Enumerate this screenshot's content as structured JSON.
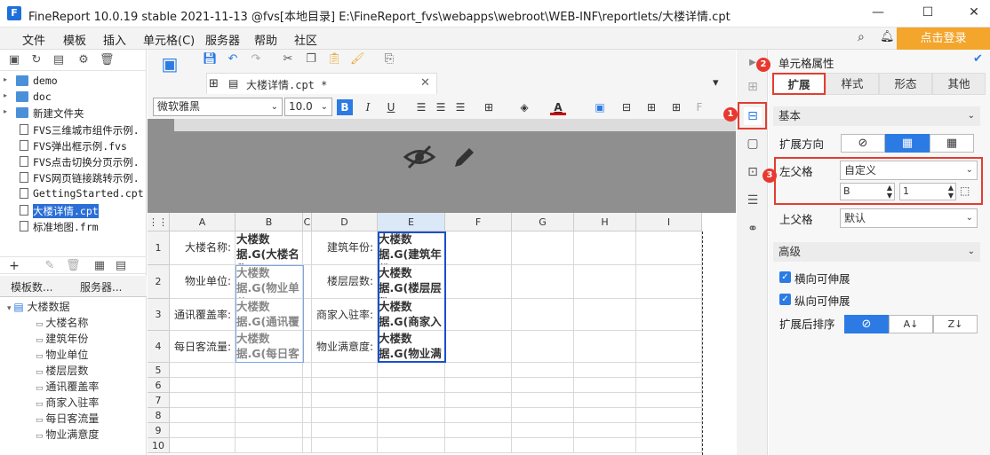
{
  "app": {
    "logo_letter": "F",
    "title": "FineReport 10.0.19 stable 2021-11-13 @fvs[本地目录]    E:\\FineReport_fvs\\webapps\\webroot\\WEB-INF\\reportlets/大楼详情.cpt",
    "login_label": "点击登录"
  },
  "menu": [
    "文件",
    "模板",
    "插入",
    "单元格(C)",
    "服务器",
    "帮助",
    "社区"
  ],
  "file_tree": [
    {
      "name": "demo",
      "type": "folder"
    },
    {
      "name": "doc",
      "type": "folder"
    },
    {
      "name": "新建文件夹",
      "type": "folder"
    },
    {
      "name": "FVS三维城市组件示例.",
      "type": "file"
    },
    {
      "name": "FVS弹出框示例.fvs",
      "type": "file"
    },
    {
      "name": "FVS点击切换分页示例.",
      "type": "file"
    },
    {
      "name": "FVS网页链接跳转示例.",
      "type": "file"
    },
    {
      "name": "GettingStarted.cpt",
      "type": "file"
    },
    {
      "name": "大楼详情.cpt",
      "type": "file",
      "selected": true
    },
    {
      "name": "标准地图.frm",
      "type": "file"
    }
  ],
  "left_tabs": [
    "模板数...",
    "服务器..."
  ],
  "dataset": {
    "name": "大楼数据",
    "fields": [
      "大楼名称",
      "建筑年份",
      "物业单位",
      "楼层层数",
      "通讯覆盖率",
      "商家入驻率",
      "每日客流量",
      "物业满意度"
    ]
  },
  "editor_tab": "大楼详情.cpt *",
  "format": {
    "font": "微软雅黑",
    "size": "10.0"
  },
  "sheet": {
    "columns": [
      "A",
      "B",
      "C",
      "D",
      "E",
      "F",
      "G",
      "H",
      "I"
    ],
    "rows": [
      "1",
      "2",
      "3",
      "4",
      "5",
      "6",
      "7",
      "8",
      "9",
      "10"
    ],
    "labels_a": [
      "大楼名称:",
      "物业单位:",
      "通讯覆盖率:",
      "每日客流量:"
    ],
    "fields_b": [
      "大楼数据.G(大楼名称)",
      "大楼数据.G(物业单位)",
      "大楼数据.G(通讯覆盖率)",
      "大楼数据.G(每日客流量)"
    ],
    "labels_d": [
      "建筑年份:",
      "楼层层数:",
      "商家入驻率:",
      "物业满意度:"
    ],
    "fields_e": [
      "大楼数据.G(建筑年份)",
      "大楼数据.G(楼层层数)",
      "大楼数据.G(商家入驻率)",
      "大楼数据.G(物业满意度)"
    ]
  },
  "panel": {
    "title": "单元格属性",
    "tabs": [
      "扩展",
      "样式",
      "形态",
      "其他"
    ],
    "section_basic": "基本",
    "expand_dir_label": "扩展方向",
    "left_parent_label": "左父格",
    "left_parent_value": "自定义",
    "left_parent_col": "B",
    "left_parent_row": "1",
    "top_parent_label": "上父格",
    "top_parent_value": "默认",
    "section_advanced": "高级",
    "check_horizontal": "横向可伸展",
    "check_vertical": "纵向可伸展",
    "sort_label": "扩展后排序"
  },
  "badges": [
    "1",
    "2",
    "3"
  ],
  "colors": {
    "accent": "#2c7be5",
    "login": "#f3a52c",
    "highlight": "#e43d30"
  }
}
